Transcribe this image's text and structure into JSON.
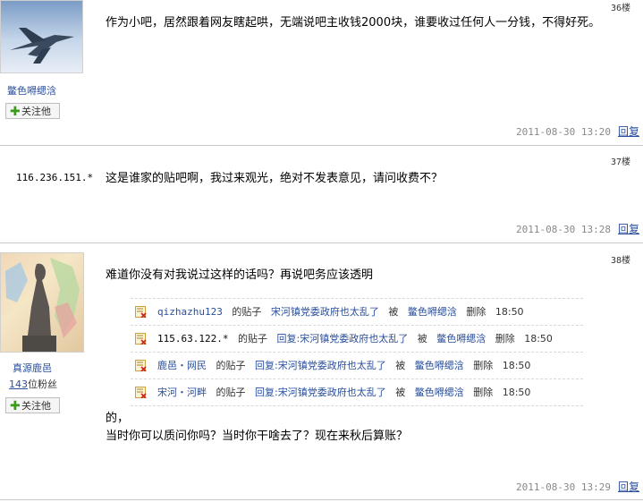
{
  "posts": [
    {
      "floor": "36楼",
      "username": "鳖色嘚缌浛",
      "follow_label": "关注他",
      "content": "作为小吧，居然跟着网友瞎起哄，无端说吧主收钱2000块，谁要收过任何人一分钱，不得好死。",
      "time": "2011-08-30  13:20",
      "reply_label": "回复"
    },
    {
      "floor": "37楼",
      "ip": "116.236.151.*",
      "content": "这是谁家的贴吧啊，我过来观光，绝对不发表意见，请问收费不？",
      "time": "2011-08-30  13:28",
      "reply_label": "回复"
    },
    {
      "floor": "38楼",
      "username": "真源鹿邑",
      "fans_count": "143",
      "fans_suffix": "位粉丝",
      "follow_label": "关注他",
      "content_top": "难道你没有对我说过这样的话吗？再说吧务应该透明",
      "log": [
        {
          "actor": "qizhazhu123",
          "post_word": "的贴子",
          "title": "宋河镇党委政府也太乱了",
          "by": "被",
          "mod": "鳖色嘚缌浛",
          "action": "删除",
          "time": "18:50"
        },
        {
          "actor": "115.63.122.*",
          "post_word": "的贴子",
          "title": "回复:宋河镇党委政府也太乱了",
          "by": "被",
          "mod": "鳖色嘚缌浛",
          "action": "删除",
          "time": "18:50"
        },
        {
          "actor": "鹿邑・网民",
          "post_word": "的贴子",
          "title": "回复:宋河镇党委政府也太乱了",
          "by": "被",
          "mod": "鳖色嘚缌浛",
          "action": "删除",
          "time": "18:50"
        },
        {
          "actor": "宋河・河畔",
          "post_word": "的贴子",
          "title": "回复:宋河镇党委政府也太乱了",
          "by": "被",
          "mod": "鳖色嘚缌浛",
          "action": "删除",
          "time": "18:50"
        }
      ],
      "content_line1": "的，",
      "content_line2": "当时你可以质问你吗？当时你干啥去了？现在来秋后算账？",
      "time": "2011-08-30  13:29",
      "reply_label": "回复"
    }
  ]
}
